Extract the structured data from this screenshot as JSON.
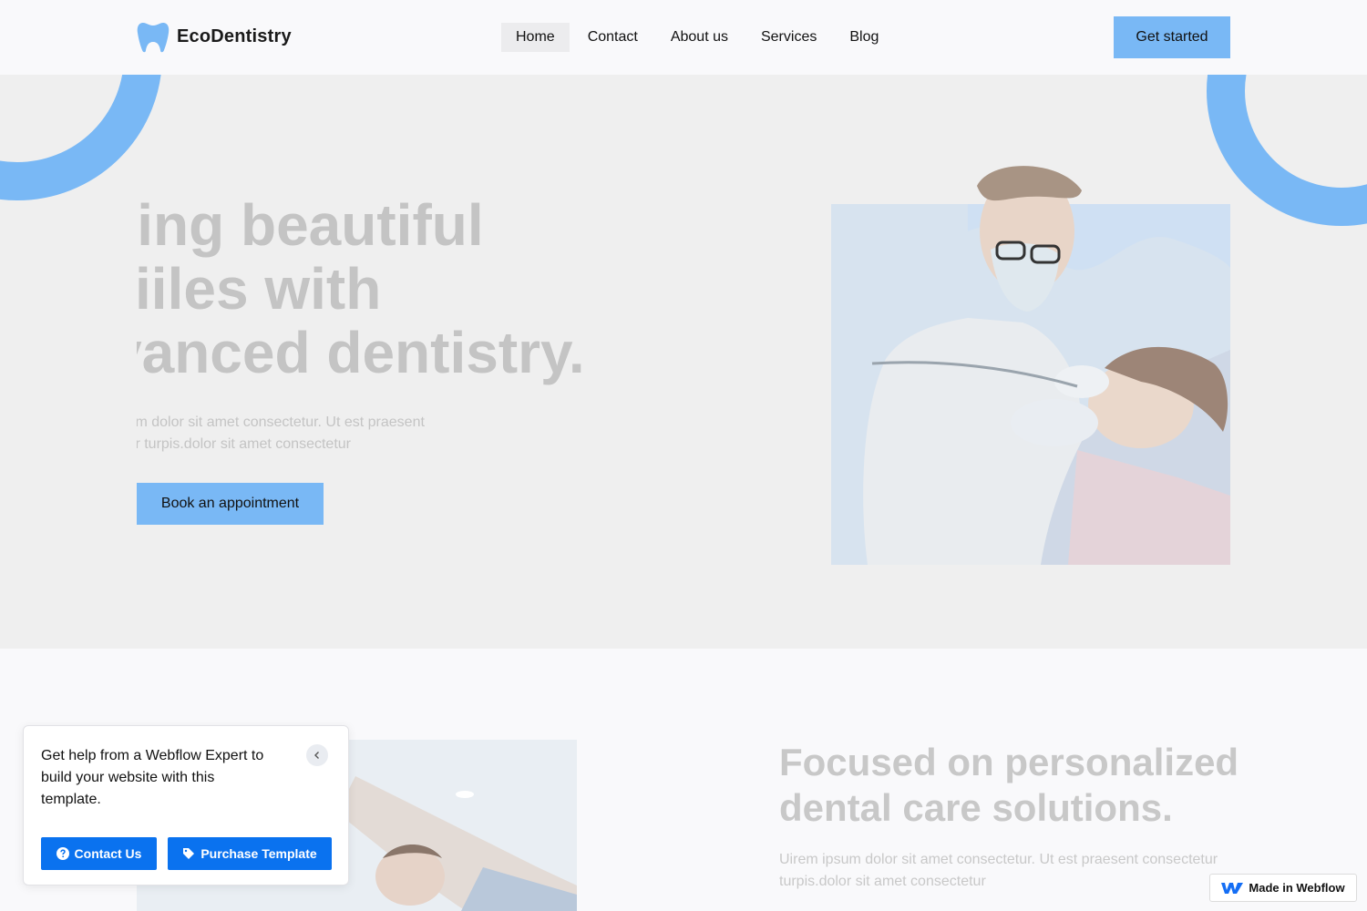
{
  "header": {
    "logo_text": "EcoDentistry",
    "nav": [
      "Home",
      "Contact",
      "About us",
      "Services",
      "Blog"
    ],
    "active_nav": "Home",
    "cta_label": "Get started"
  },
  "hero": {
    "title_lines": [
      "afting beautiful",
      "iiles with",
      "vanced dentistry."
    ],
    "subtitle_lines": [
      "ım dolor sit amet consectetur. Ut est praesent",
      "ır turpis.dolor sit amet consectetur"
    ],
    "book_label": "Book an appointment"
  },
  "section2": {
    "title": "Focused on personalized dental care solutions.",
    "text": "Uirem ipsum dolor sit amet consectetur. Ut est praesent consectetur turpis.dolor sit amet consectetur"
  },
  "popup": {
    "text": "Get help from a Webflow Expert to build your website with this template.",
    "contact_label": "Contact Us",
    "purchase_label": "Purchase Template"
  },
  "badge": {
    "label": "Made in Webflow"
  },
  "colors": {
    "accent": "#79b8f5",
    "button_blue": "#0a72ef",
    "hero_bg": "#efefef"
  }
}
